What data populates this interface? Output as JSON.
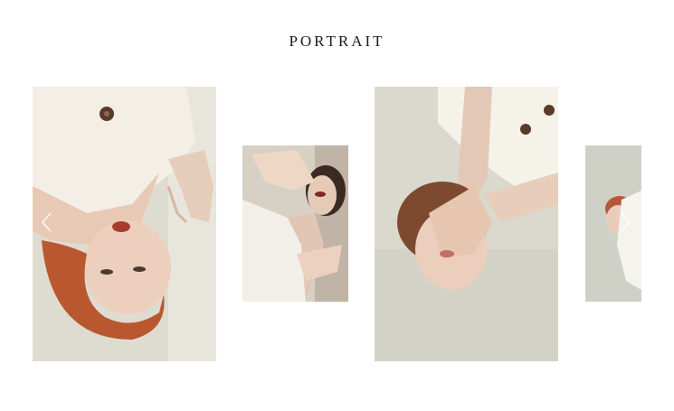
{
  "gallery": {
    "title": "PORTRAIT"
  },
  "slides": [
    {
      "name": "portrait-photo-1"
    },
    {
      "name": "portrait-photo-2"
    },
    {
      "name": "portrait-photo-3"
    },
    {
      "name": "portrait-photo-4"
    }
  ],
  "controls": {
    "prev_icon": "chevron-left-icon",
    "next_icon": "chevron-right-icon"
  },
  "colors": {
    "background": "#ffffff",
    "title": "#1a1a1a",
    "photo_backdrop": "#e0ddd1",
    "hair": "#b5582f",
    "skin": "#ead2c0",
    "shirt": "#f6f4ee"
  }
}
